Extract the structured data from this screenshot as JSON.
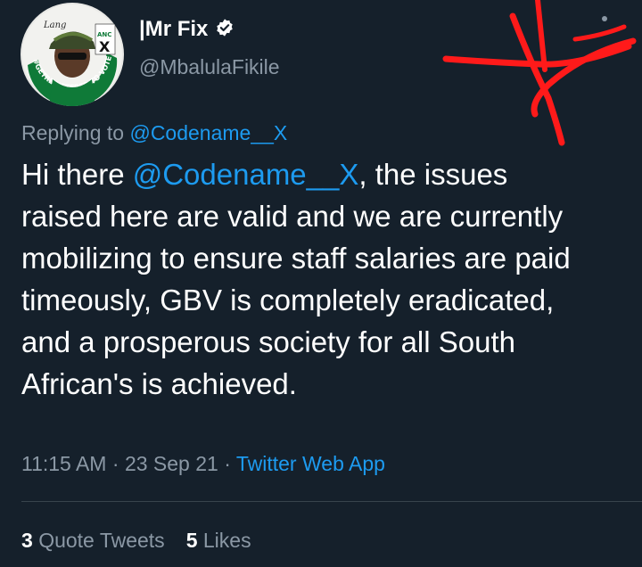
{
  "author": {
    "display_name": "|Mr Fix",
    "handle": "@MbalulaFikile",
    "verified": true,
    "avatar_badge_text": "#GETREGISTERED TO VOTE ANC",
    "avatar_cap_text": "Lang",
    "avatar_sticker_text": "ANC"
  },
  "reply": {
    "prefix": "Replying to",
    "to": "@Codename__X"
  },
  "tweet": {
    "text_before": "Hi there ",
    "mention": "@Codename__X",
    "text_after": ", the issues raised here are valid and we are currently mobilizing to ensure staff salaries are paid timeously, GBV is completely eradicated, and a prosperous society for all South African's is achieved."
  },
  "meta": {
    "time": "11:15 AM",
    "separator": "·",
    "date": "23 Sep 21",
    "source": "Twitter Web App"
  },
  "stats": {
    "quote_tweets_count": "3",
    "quote_tweets_label": "Quote Tweets",
    "likes_count": "5",
    "likes_label": "Likes"
  },
  "colors": {
    "background": "#15202b",
    "text": "#ffffff",
    "muted": "#8b98a5",
    "link": "#1d9bf0",
    "scribble": "#ff1a1a"
  }
}
